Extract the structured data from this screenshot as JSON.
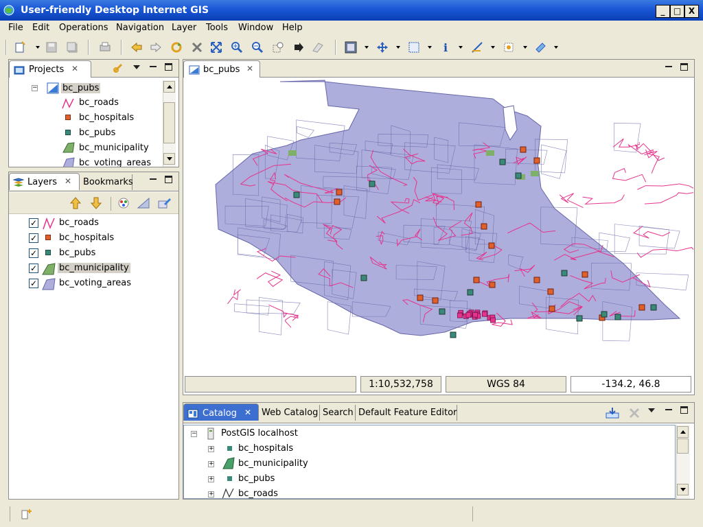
{
  "window": {
    "title": "User-friendly Desktop Internet GIS",
    "controls": {
      "minimize": "_",
      "maximize": "□",
      "close": "X"
    }
  },
  "menu": [
    "File",
    "Edit",
    "Operations",
    "Navigation",
    "Layer",
    "Tools",
    "Window",
    "Help"
  ],
  "toolbar": {
    "icons": [
      "new-icon",
      "save-icon",
      "save-all-icon",
      "print-icon",
      "back-icon",
      "forward-icon",
      "refresh-icon",
      "stop-icon",
      "zoom-extent-icon",
      "zoom-in-icon",
      "zoom-out-icon",
      "zoom-box-icon",
      "pan-forward-icon",
      "eraser-icon",
      "map-export-icon",
      "pan-icon",
      "select-box-icon",
      "info-icon",
      "edit-tool-icon",
      "feature-tool-icon",
      "plugin-icon"
    ]
  },
  "projects_view": {
    "tab_label": "Projects",
    "tree": {
      "project": "bc_pubs",
      "children": [
        "bc_roads",
        "bc_hospitals",
        "bc_pubs",
        "bc_municipality",
        "bc_voting_areas"
      ]
    }
  },
  "layers_view": {
    "tab_label": "Layers",
    "bookmarks_tab": "Bookmarks",
    "layers": [
      {
        "name": "bc_roads",
        "checked": true,
        "icon": "road-line-icon",
        "selected": false
      },
      {
        "name": "bc_hospitals",
        "checked": true,
        "icon": "point-orange-icon",
        "selected": false
      },
      {
        "name": "bc_pubs",
        "checked": true,
        "icon": "point-teal-icon",
        "selected": false
      },
      {
        "name": "bc_municipality",
        "checked": true,
        "icon": "polygon-green-icon",
        "selected": true
      },
      {
        "name": "bc_voting_areas",
        "checked": true,
        "icon": "polygon-purple-icon",
        "selected": false
      }
    ],
    "check_mark": "✓"
  },
  "map_view": {
    "tab_label": "bc_pubs",
    "colors": {
      "polygon_fill": "#aeaedc",
      "polygon_stroke": "#6666aa",
      "roads": "#e6338c",
      "hospitals": "#e0602c",
      "pubs": "#3a8a7c",
      "municipality": "#7fb06a"
    },
    "status": {
      "scale": "1:10,532,758",
      "crs": "WGS 84",
      "coordinates": "-134.2, 46.8"
    }
  },
  "catalog_view": {
    "tabs": [
      "Catalog",
      "Web Catalog",
      "Search",
      "Default Feature Editor"
    ],
    "active_tab": "Catalog",
    "tree": {
      "root": "PostGIS localhost",
      "children": [
        "bc_hospitals",
        "bc_municipality",
        "bc_pubs",
        "bc_roads"
      ]
    }
  }
}
